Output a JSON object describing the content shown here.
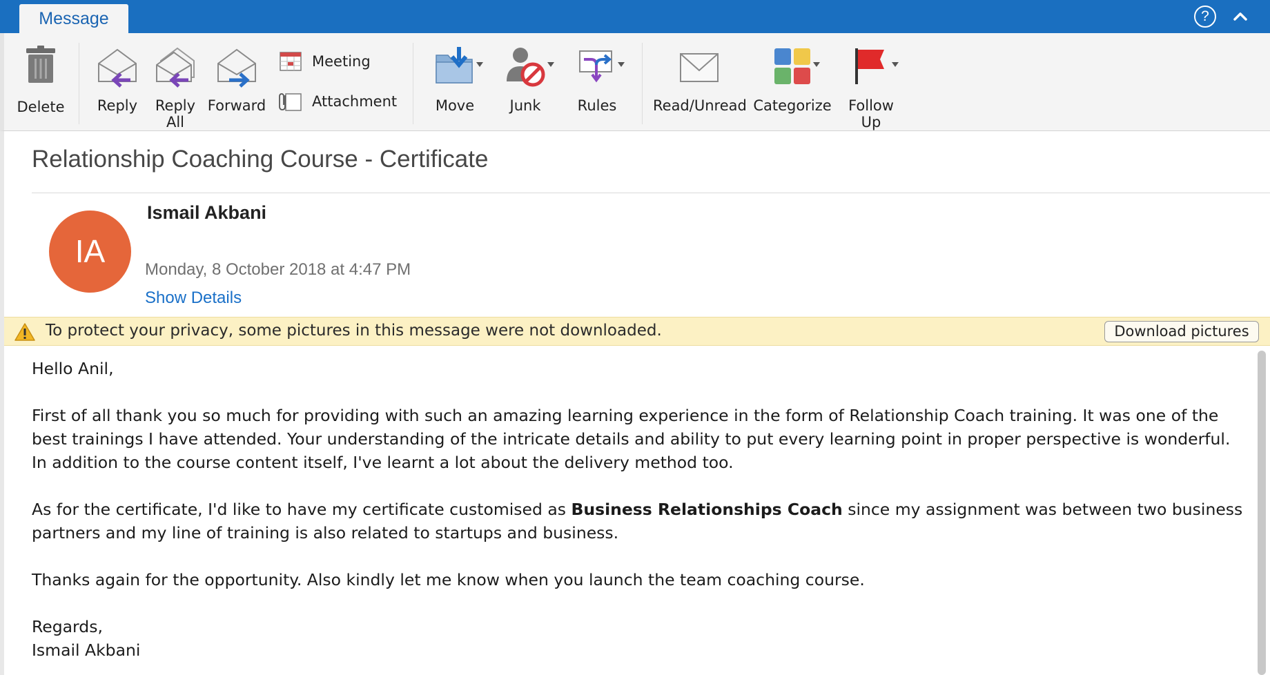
{
  "tab": {
    "label": "Message"
  },
  "topbar": {
    "help_label": "?"
  },
  "ribbon": {
    "delete": "Delete",
    "reply": "Reply",
    "reply_all_1": "Reply",
    "reply_all_2": "All",
    "forward": "Forward",
    "meeting": "Meeting",
    "attachment": "Attachment",
    "move": "Move",
    "junk": "Junk",
    "rules": "Rules",
    "read_unread": "Read/Unread",
    "categorize": "Categorize",
    "follow_up_1": "Follow",
    "follow_up_2": "Up"
  },
  "message": {
    "subject": "Relationship Coaching Course - Certificate",
    "avatar_initials": "IA",
    "sender": "Ismail Akbani",
    "date": "Monday, 8 October 2018 at 4:47 PM",
    "show_details": "Show Details"
  },
  "privacy": {
    "text": "To protect your privacy, some pictures in this message were not downloaded.",
    "button": "Download pictures"
  },
  "body": {
    "greeting": "Hello Anil,",
    "para1": "First of all thank you so much for providing with such an amazing learning experience in the form of Relationship Coach training. It was one of the best trainings I have attended. Your understanding of the intricate details and ability to put every learning point in proper perspective is wonderful. In addition to the course content itself, I've learnt a lot about the delivery method too.",
    "para2_before": "As for the certificate, I'd like to have my certificate customised as ",
    "para2_bold": "Business Relationships Coach",
    "para2_after": " since my assignment was between two business partners and my line of training is also related to startups and business.",
    "para3": "Thanks again for the opportunity. Also kindly let me know when you launch the team coaching course.",
    "closing": "Regards,",
    "signature": "Ismail Akbani"
  },
  "colors": {
    "titlebar": "#1a6fc0",
    "avatar": "#e5663a",
    "link": "#1a70c8",
    "privacy_bar": "#fcf1c4"
  }
}
